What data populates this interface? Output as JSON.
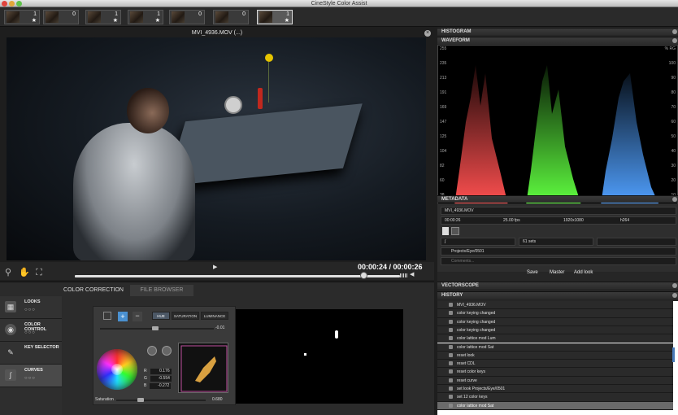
{
  "window": {
    "title": "CineStyle Color Assist"
  },
  "thumbnails": [
    {
      "count": "1",
      "star": "★"
    },
    {
      "count": "0",
      "star": ""
    },
    {
      "count": "1",
      "star": "★"
    },
    {
      "count": "1",
      "star": "★"
    },
    {
      "count": "0",
      "star": ""
    },
    {
      "count": "0",
      "star": ""
    },
    {
      "count": "1",
      "star": "★"
    }
  ],
  "viewer": {
    "title": "MVI_4936.MOV (...)",
    "timecode": "00:00:24 / 00:00:26",
    "close": "×",
    "play": "▶",
    "speaker": "◀"
  },
  "right": {
    "histogram_label": "HISTOGRAM",
    "waveform_label": "WAVEFORM",
    "wave_left_axis": [
      "255",
      "235",
      "213",
      "191",
      "169",
      "147",
      "125",
      "104",
      "82",
      "60",
      "38",
      "16"
    ],
    "wave_right_axis": [
      "% RG",
      "100",
      "90",
      "80",
      "70",
      "60",
      "50",
      "40",
      "30",
      "20",
      "10",
      "0"
    ],
    "metadata_label": "METADATA",
    "meta": {
      "filename": "MVI_4936.MOV",
      "time": "00:00:26",
      "fps": "25.00 fps",
      "resolution": "1920x1080",
      "codec": "h264",
      "sets": "61 sets",
      "path": "Projects/Eye/0501",
      "comments_placeholder": "Comments..."
    },
    "meta_buttons": {
      "save": "Save",
      "master": "Master",
      "add_look": "Add look"
    },
    "vectorscope_label": "VECTORSCOPE",
    "history_label": "HISTORY",
    "history": [
      "MVI_4936.MOV",
      "color keying changed",
      "color keying changed",
      "color keying changed",
      "color lattice mod Lum",
      "color lattice mod Sat",
      "reset look",
      "reset CDL",
      "reset color keys",
      "reset curve",
      "set look Projects/Eye/0501",
      "set 12 color keys",
      "color lattice mod Sat"
    ]
  },
  "tabs": {
    "color_correction": "COLOR CORRECTION",
    "file_browser": "FILE BROWSER"
  },
  "left_panel": [
    {
      "label": "LOOKS",
      "sub": "○○○"
    },
    {
      "label": "COLOR CONTROL",
      "sub": "○○○"
    },
    {
      "label": "KEY SELECTOR",
      "sub": ""
    },
    {
      "label": "CURVES",
      "sub": "○○○"
    }
  ],
  "cc": {
    "modes": [
      "HUE",
      "SATURATION",
      "LUMINANCE"
    ],
    "top_value": "-0.01",
    "r_label": "R",
    "g_label": "G",
    "b_label": "B",
    "r": "0.176",
    "g": "-0.554",
    "b": "-0.272",
    "saturation_label": "Saturation",
    "saturation_value": "0.680"
  }
}
